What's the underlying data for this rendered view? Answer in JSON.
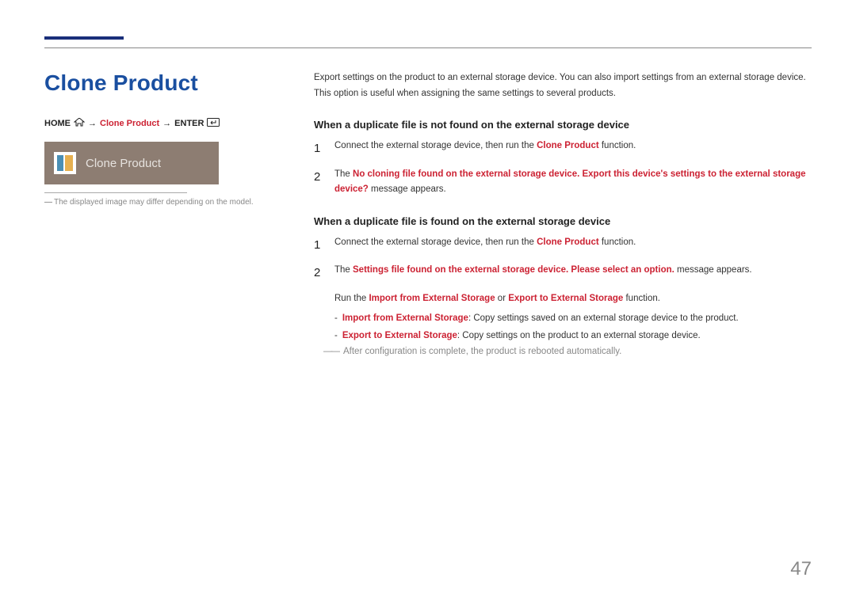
{
  "title": "Clone Product",
  "breadcrumb": {
    "home": "HOME",
    "arrow": "→",
    "mid": "Clone Product",
    "enter": "ENTER"
  },
  "banner": {
    "label": "Clone Product"
  },
  "footnote": "The displayed image may differ depending on the model.",
  "intro": {
    "l1": "Export settings on the product to an external storage device. You can also import settings from an external storage device.",
    "l2": "This option is useful when assigning the same settings to several products."
  },
  "sectionA": {
    "heading": "When a duplicate file is not found on the external storage device",
    "step1_pre": "Connect the external storage device, then run the ",
    "step1_accent": "Clone Product",
    "step1_post": " function.",
    "step2_pre": "The ",
    "step2_accent": "No cloning file found on the external storage device. Export this device's settings to the external storage device?",
    "step2_post": " message appears."
  },
  "sectionB": {
    "heading": "When a duplicate file is found on the external storage device",
    "step1_pre": "Connect the external storage device, then run the ",
    "step1_accent": "Clone Product",
    "step1_post": " function.",
    "step2_pre": "The ",
    "step2_accent": "Settings file found on the external storage device. Please select an option.",
    "step2_post": " message appears.",
    "run_pre": "Run the ",
    "run_a": "Import from External Storage",
    "run_mid": " or ",
    "run_b": "Export to External Storage",
    "run_post": " function.",
    "bullet1_label": "Import from External Storage",
    "bullet1_text": ": Copy settings saved on an external storage device to the product.",
    "bullet2_label": "Export to External Storage",
    "bullet2_text": ": Copy settings on the product to an external storage device.",
    "note": "After configuration is complete, the product is rebooted automatically."
  },
  "pageNumber": "47"
}
